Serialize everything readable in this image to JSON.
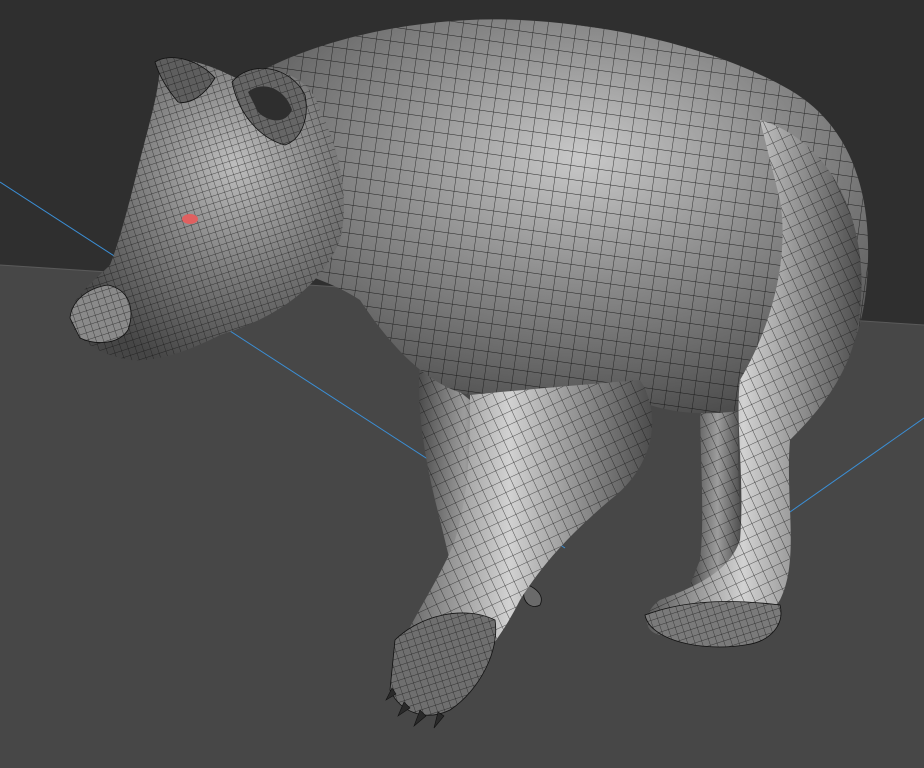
{
  "viewport": {
    "background_sky": "#2f2f2f",
    "background_floor": "#474747",
    "horizon_line_color": "#5a5a5a",
    "axis_line_color": "#3b8fd6",
    "mesh_base_color": "#6e6e6e",
    "mesh_highlight_color": "#d8d8d8",
    "wire_color": "#111111",
    "eye_color": "#e06060"
  },
  "model": {
    "subject_icon": "bear-sculpt-icon",
    "render_mode": "shaded-wireframe"
  }
}
